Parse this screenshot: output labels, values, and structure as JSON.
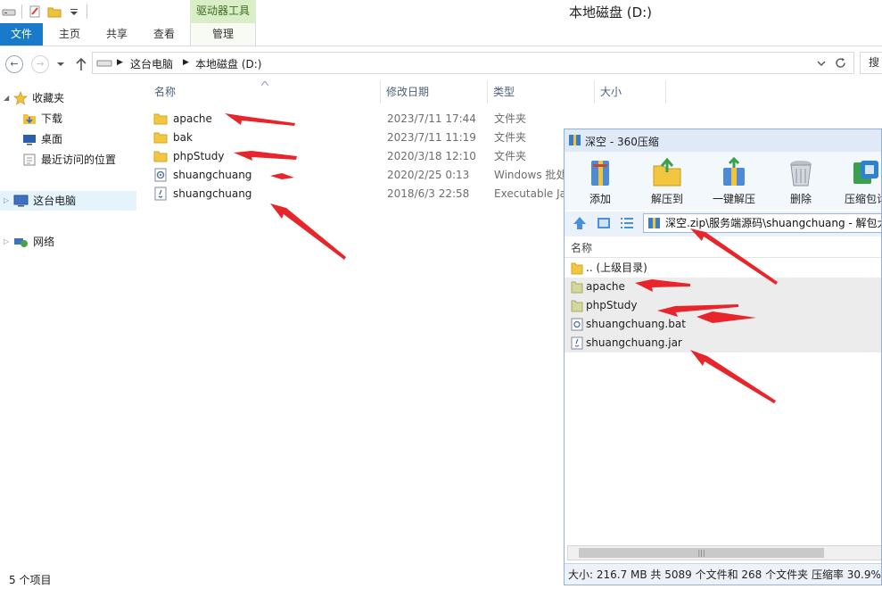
{
  "window": {
    "title": "本地磁盘 (D:)",
    "context_tab": "驱动器工具"
  },
  "ribbon": {
    "tabs": [
      "文件",
      "主页",
      "共享",
      "查看",
      "管理"
    ]
  },
  "address": {
    "crumbs": [
      "这台电脑",
      "本地磁盘 (D:)"
    ],
    "search_label": "搜"
  },
  "nav": {
    "favorites": "收藏夹",
    "downloads": "下载",
    "desktop": "桌面",
    "recent": "最近访问的位置",
    "this_pc": "这台电脑",
    "network": "网络"
  },
  "columns": [
    "名称",
    "修改日期",
    "类型",
    "大小"
  ],
  "files": [
    {
      "name": "apache",
      "date": "2023/7/11 17:44",
      "type": "文件夹",
      "icon": "folder-icon"
    },
    {
      "name": "bak",
      "date": "2023/7/11 11:19",
      "type": "文件夹",
      "icon": "folder-icon"
    },
    {
      "name": "phpStudy",
      "date": "2020/3/18 12:10",
      "type": "文件夹",
      "icon": "folder-icon"
    },
    {
      "name": "shuangchuang",
      "date": "2020/2/25 0:13",
      "type": "Windows 批处",
      "icon": "batch-file-icon"
    },
    {
      "name": "shuangchuang",
      "date": "2018/6/3 22:58",
      "type": "Executable Ja",
      "icon": "jar-file-icon"
    }
  ],
  "status": "5 个项目",
  "zip": {
    "title": "深空 - 360压缩",
    "tools": [
      "添加",
      "解压到",
      "一键解压",
      "删除",
      "压缩包诊"
    ],
    "path": "深空.zip\\服务端源码\\shuangchuang - 解包大",
    "column": "名称",
    "items": [
      {
        "name": ".. (上级目录)",
        "icon": "folder-up-icon"
      },
      {
        "name": "apache",
        "icon": "folder-icon"
      },
      {
        "name": "phpStudy",
        "icon": "folder-icon"
      },
      {
        "name": "shuangchuang.bat",
        "icon": "batch-file-icon"
      },
      {
        "name": "shuangchuang.jar",
        "icon": "jar-file-icon"
      }
    ],
    "status": "大小: 216.7 MB 共 5089 个文件和 268 个文件夹 压缩率 30.9% 已"
  },
  "colors": {
    "accent": "#1979ca",
    "arrow": "#e8252a",
    "context_tab": "#d9eec7"
  }
}
